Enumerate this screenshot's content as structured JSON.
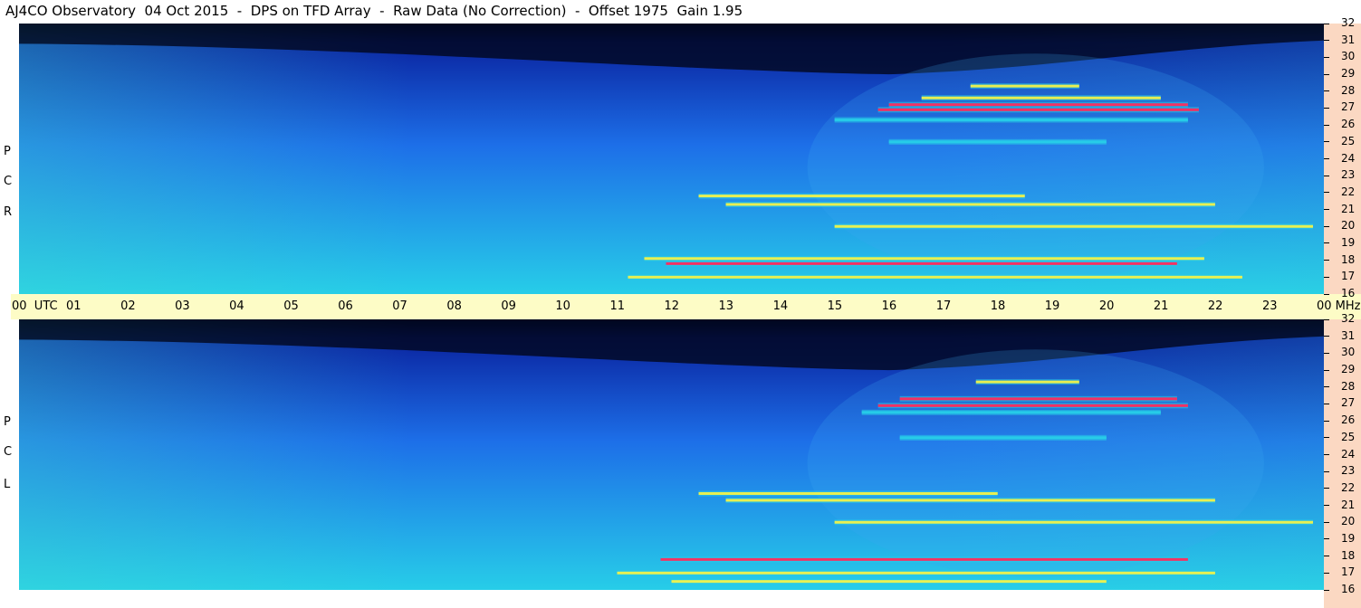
{
  "title": "AJ4CO Observatory  04 Oct 2015  -  DPS on TFD Array  -  Raw Data (No Correction)  -  Offset 1975  Gain 1.95",
  "panels": [
    {
      "id": "rcp",
      "label_letters": [
        "R",
        "C",
        "P"
      ]
    },
    {
      "id": "lcp",
      "label_letters": [
        "L",
        "C",
        "P"
      ]
    }
  ],
  "time_axis": {
    "unit_label": "UTC",
    "labels": [
      "00",
      "01",
      "02",
      "03",
      "04",
      "05",
      "06",
      "07",
      "08",
      "09",
      "10",
      "11",
      "12",
      "13",
      "14",
      "15",
      "16",
      "17",
      "18",
      "19",
      "20",
      "21",
      "22",
      "23",
      "00"
    ]
  },
  "freq_axis": {
    "unit_label": "MHz",
    "labels": [
      "32",
      "31",
      "30",
      "29",
      "28",
      "27",
      "26",
      "25",
      "24",
      "23",
      "22",
      "21",
      "20",
      "19",
      "18",
      "17",
      "16"
    ]
  },
  "colors": {
    "background_noise_low": "#0a2aa8",
    "background_noise_mid": "#1d6fe8",
    "background_noise_high": "#27cde8",
    "signal_yellow": "#f2f24a",
    "signal_red": "#ff2a5c",
    "mhz_strip": "#fbd8c2",
    "utc_strip": "#fdfcc6"
  },
  "chart_data": {
    "type": "heatmap",
    "title": "AJ4CO Observatory  04 Oct 2015  -  DPS on TFD Array  -  Raw Data (No Correction)  -  Offset 1975  Gain 1.95",
    "xlabel": "UTC",
    "ylabel": "MHz",
    "xlim": [
      0,
      24
    ],
    "ylim": [
      16,
      32
    ],
    "x_ticks": [
      "00",
      "01",
      "02",
      "03",
      "04",
      "05",
      "06",
      "07",
      "08",
      "09",
      "10",
      "11",
      "12",
      "13",
      "14",
      "15",
      "16",
      "17",
      "18",
      "19",
      "20",
      "21",
      "22",
      "23",
      "00"
    ],
    "y_ticks": [
      32,
      31,
      30,
      29,
      28,
      27,
      26,
      25,
      24,
      23,
      22,
      21,
      20,
      19,
      18,
      17,
      16
    ],
    "series": [
      {
        "name": "RCP",
        "bands": [
          {
            "freq": 17.8,
            "start": 11.9,
            "end": 21.3,
            "level": "high"
          },
          {
            "freq": 17.0,
            "start": 11.2,
            "end": 22.5,
            "level": "mid"
          },
          {
            "freq": 18.1,
            "start": 11.5,
            "end": 21.8,
            "level": "mid"
          },
          {
            "freq": 20.0,
            "start": 15.0,
            "end": 23.8,
            "level": "mid"
          },
          {
            "freq": 21.3,
            "start": 13.0,
            "end": 22.0,
            "level": "mid"
          },
          {
            "freq": 21.8,
            "start": 12.5,
            "end": 18.5,
            "level": "mid"
          },
          {
            "freq": 25.0,
            "start": 16.0,
            "end": 20.0,
            "level": "low"
          },
          {
            "freq": 26.3,
            "start": 15.0,
            "end": 21.5,
            "level": "low"
          },
          {
            "freq": 26.9,
            "start": 15.8,
            "end": 21.7,
            "level": "high"
          },
          {
            "freq": 27.2,
            "start": 16.0,
            "end": 21.5,
            "level": "high"
          },
          {
            "freq": 27.6,
            "start": 16.6,
            "end": 21.0,
            "level": "mid"
          },
          {
            "freq": 28.3,
            "start": 17.5,
            "end": 19.5,
            "level": "mid"
          }
        ]
      },
      {
        "name": "LCP",
        "bands": [
          {
            "freq": 17.8,
            "start": 11.8,
            "end": 21.5,
            "level": "high"
          },
          {
            "freq": 17.0,
            "start": 11.0,
            "end": 22.0,
            "level": "mid"
          },
          {
            "freq": 16.5,
            "start": 12.0,
            "end": 20.0,
            "level": "mid"
          },
          {
            "freq": 20.0,
            "start": 15.0,
            "end": 23.8,
            "level": "mid"
          },
          {
            "freq": 21.3,
            "start": 13.0,
            "end": 22.0,
            "level": "mid"
          },
          {
            "freq": 21.7,
            "start": 12.5,
            "end": 18.0,
            "level": "mid"
          },
          {
            "freq": 25.0,
            "start": 16.2,
            "end": 20.0,
            "level": "low"
          },
          {
            "freq": 26.5,
            "start": 15.5,
            "end": 21.0,
            "level": "low"
          },
          {
            "freq": 26.9,
            "start": 15.8,
            "end": 21.5,
            "level": "high"
          },
          {
            "freq": 27.3,
            "start": 16.2,
            "end": 21.3,
            "level": "high"
          },
          {
            "freq": 28.3,
            "start": 17.6,
            "end": 19.5,
            "level": "mid"
          }
        ]
      }
    ]
  }
}
